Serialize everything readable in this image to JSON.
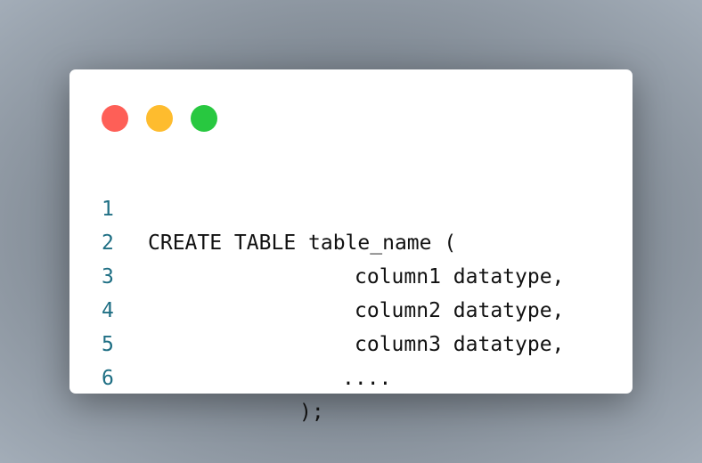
{
  "window": {
    "controls": {
      "close_color": "#fe5f57",
      "minimize_color": "#febc2e",
      "maximize_color": "#28c840"
    }
  },
  "code": {
    "lines": [
      {
        "number": "1",
        "text": "CREATE TABLE table_name ("
      },
      {
        "number": "2",
        "text": "column1 datatype,"
      },
      {
        "number": "3",
        "text": "column2 datatype,"
      },
      {
        "number": "4",
        "text": "column3 datatype,"
      },
      {
        "number": "5",
        "text": "...."
      },
      {
        "number": "6",
        "text": ");"
      }
    ]
  }
}
